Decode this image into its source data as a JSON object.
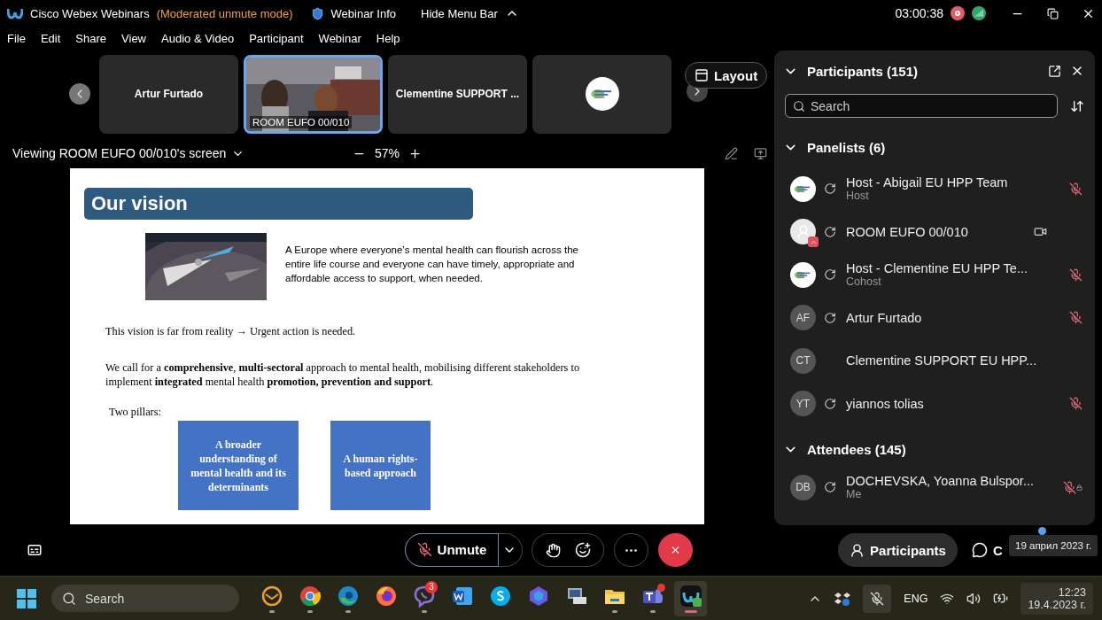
{
  "title_bar": {
    "app_name": "Cisco Webex Webinars",
    "mode": "(Moderated unmute mode)",
    "webinar_info": "Webinar Info",
    "hide_menu": "Hide Menu Bar",
    "timer": "03:00:38",
    "recording": true
  },
  "menu": [
    "File",
    "Edit",
    "Share",
    "View",
    "Audio & Video",
    "Participant",
    "Webinar",
    "Help"
  ],
  "filmstrip": {
    "tiles": [
      {
        "kind": "name",
        "label": "Artur Furtado",
        "selected": false
      },
      {
        "kind": "video",
        "label": "ROOM EUFO 00/010",
        "selected": true
      },
      {
        "kind": "name",
        "label": "Clementine SUPPORT  ...",
        "selected": false
      },
      {
        "kind": "logo",
        "selected": false
      }
    ],
    "layout_button": "Layout"
  },
  "viewing": {
    "label": "Viewing ROOM EUFO 00/010's screen",
    "zoom": "57%"
  },
  "slide": {
    "title": "Our vision",
    "vision_text": "A Europe where everyone’s mental health can flourish across the entire life course and everyone can have timely, appropriate and affordable access to support, when needed.",
    "reality_text": "This vision is far from reality → Urgent action is needed.",
    "call_text": "We call for a **comprehensive**, **multi-sectoral** approach to mental health, mobilising different stakeholders to implement **integrated** mental health **promotion, prevention and support**.",
    "pillars_label": "Two pillars:",
    "pillars": [
      "A broader understanding of mental health and its determinants",
      "A human rights-based approach"
    ]
  },
  "panel": {
    "title": "Participants (151)",
    "search": {
      "placeholder": "Search"
    },
    "sections": [
      {
        "title": "Panelists (6)",
        "expanded": true,
        "members": [
          {
            "name": "Host - Abigail EU HPP Team",
            "role": "Host",
            "avatar": {
              "kind": "logo"
            },
            "connected": true,
            "muted": true,
            "mic_locked": false,
            "camera": false
          },
          {
            "name": "ROOM EUFO 00/010",
            "avatar": {
              "kind": "sharing"
            },
            "connected": true,
            "muted": false,
            "mic_locked": false,
            "camera": true
          },
          {
            "name": "Host - Clementine EU HPP Te...",
            "role": "Cohost",
            "avatar": {
              "kind": "logo"
            },
            "connected": true,
            "muted": true,
            "mic_locked": false,
            "camera": false
          },
          {
            "name": "Artur Furtado",
            "avatar": {
              "kind": "initials",
              "initials": "AF"
            },
            "connected": true,
            "muted": true,
            "mic_locked": false,
            "camera": false
          },
          {
            "name": "Clementine SUPPORT  EU HPP...",
            "avatar": {
              "kind": "initials",
              "initials": "CT"
            },
            "connected": false,
            "muted": false,
            "mic_locked": false,
            "camera": false
          },
          {
            "name": "yiannos tolias",
            "avatar": {
              "kind": "initials",
              "initials": "YT"
            },
            "connected": true,
            "muted": true,
            "mic_locked": false,
            "camera": false
          }
        ]
      },
      {
        "title": "Attendees (145)",
        "expanded": true,
        "members": [
          {
            "name": "DOCHEVSKA, Yoanna Bulspor...",
            "role": "Me",
            "avatar": {
              "kind": "initials",
              "initials": "DB"
            },
            "connected": true,
            "muted": true,
            "mic_locked": true,
            "camera": false
          }
        ]
      }
    ]
  },
  "controls": {
    "unmute": "Unmute",
    "participants": "Participants",
    "chat": "C",
    "tooltip": "19 април 2023 г."
  },
  "taskbar": {
    "search": {
      "placeholder": "Search"
    },
    "apps": [
      {
        "kind": "mail",
        "running": true,
        "active": false
      },
      {
        "kind": "chrome",
        "running": true,
        "active": false
      },
      {
        "kind": "edge",
        "running": true,
        "active": false
      },
      {
        "kind": "firefox",
        "running": false,
        "active": false
      },
      {
        "kind": "viber",
        "badge": "3",
        "running": true,
        "active": false
      },
      {
        "kind": "word",
        "running": false,
        "active": false
      },
      {
        "kind": "skype",
        "running": false,
        "active": false
      },
      {
        "kind": "copilot",
        "running": false,
        "active": false
      },
      {
        "kind": "computer",
        "running": false,
        "active": false
      },
      {
        "kind": "folder",
        "running": true,
        "active": false
      },
      {
        "kind": "teams",
        "running": true,
        "active": false,
        "alert": true
      },
      {
        "kind": "webex",
        "running": true,
        "active": true
      }
    ],
    "language": "ENG",
    "time": "12:23",
    "date": "19.4.2023 г."
  }
}
